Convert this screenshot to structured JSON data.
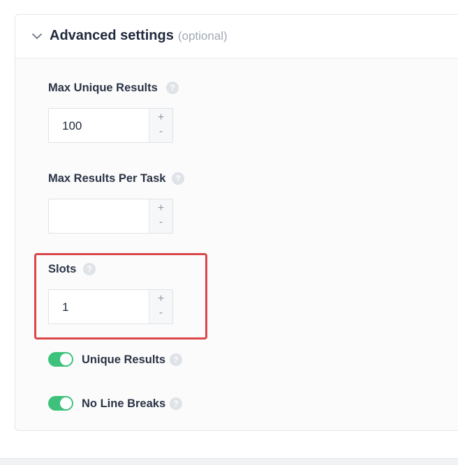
{
  "section": {
    "title": "Advanced settings",
    "optional": "(optional)"
  },
  "fields": [
    {
      "label": "Max Unique Results",
      "value": "100",
      "plus": "+",
      "minus": "-"
    },
    {
      "label": "Max Results Per Task",
      "value": "",
      "plus": "+",
      "minus": "-"
    },
    {
      "label": "Slots",
      "value": "1",
      "plus": "+",
      "minus": "-"
    }
  ],
  "toggles": [
    {
      "label": "Unique Results",
      "on": true
    },
    {
      "label": "No Line Breaks",
      "on": true
    }
  ],
  "help_glyph": "?",
  "colors": {
    "toggle_on": "#3ec27b",
    "highlight": "#d9474a",
    "help": "#dfe2e7"
  }
}
